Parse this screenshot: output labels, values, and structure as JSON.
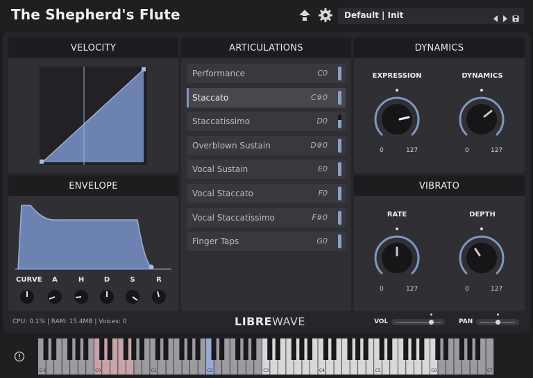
{
  "app": {
    "title": "The Shepherd's Flute",
    "header_icons": {
      "upload": "arrow-up-icon",
      "settings": "gear-icon"
    },
    "preset": {
      "name": "Default | Init",
      "prev_icon": "triangle-left-icon",
      "next_icon": "triangle-right-icon",
      "save_icon": "save-icon"
    }
  },
  "velocity": {
    "title": "VELOCITY"
  },
  "envelope": {
    "title": "ENVELOPE",
    "knobs": [
      "CURVE",
      "A",
      "H",
      "D",
      "S",
      "R"
    ]
  },
  "articulations": {
    "title": "ARTICULATIONS",
    "items": [
      {
        "label": "Performance",
        "note": "C0",
        "level": 1.0,
        "selected": false
      },
      {
        "label": "Staccato",
        "note": "C#0",
        "level": 1.0,
        "selected": true
      },
      {
        "label": "Staccatissimo",
        "note": "D0",
        "level": 0.6,
        "selected": false
      },
      {
        "label": "Overblown Sustain",
        "note": "D#0",
        "level": 1.0,
        "selected": false
      },
      {
        "label": "Vocal Sustain",
        "note": "E0",
        "level": 1.0,
        "selected": false
      },
      {
        "label": "Vocal Staccato",
        "note": "F0",
        "level": 1.0,
        "selected": false
      },
      {
        "label": "Vocal Staccatissimo",
        "note": "F#0",
        "level": 1.0,
        "selected": false
      },
      {
        "label": "Finger Taps",
        "note": "G0",
        "level": 1.0,
        "selected": false
      }
    ]
  },
  "dynamics": {
    "title": "DYNAMICS",
    "knobs": [
      {
        "label": "EXPRESSION",
        "min": "0",
        "max": "127"
      },
      {
        "label": "DYNAMICS",
        "min": "0",
        "max": "127"
      }
    ]
  },
  "vibrato": {
    "title": "VIBRATO",
    "knobs": [
      {
        "label": "RATE",
        "min": "0",
        "max": "127"
      },
      {
        "label": "DEPTH",
        "min": "0",
        "max": "127"
      }
    ]
  },
  "footer": {
    "stats": "CPU: 0.1% | RAM: 15.4MB | Voices: 0",
    "brand_part1": "LIBRE",
    "brand_part2": "WAVE",
    "vol_label": "VOL",
    "pan_label": "PAN"
  },
  "keyboard": {
    "info_icon": "info-icon",
    "octave_labels": [
      "C-1",
      "C0",
      "C1",
      "C2",
      "C3",
      "C4",
      "C5",
      "C6",
      "C7"
    ],
    "colors": {
      "keyswitch": "#c8a4a8",
      "active_key": "#9aa8d8",
      "white_key": "#d8d8da",
      "out_of_range": "#9b9ba0"
    }
  },
  "colors": {
    "accent": "#7f97c4",
    "fill": "#6c82b0"
  }
}
